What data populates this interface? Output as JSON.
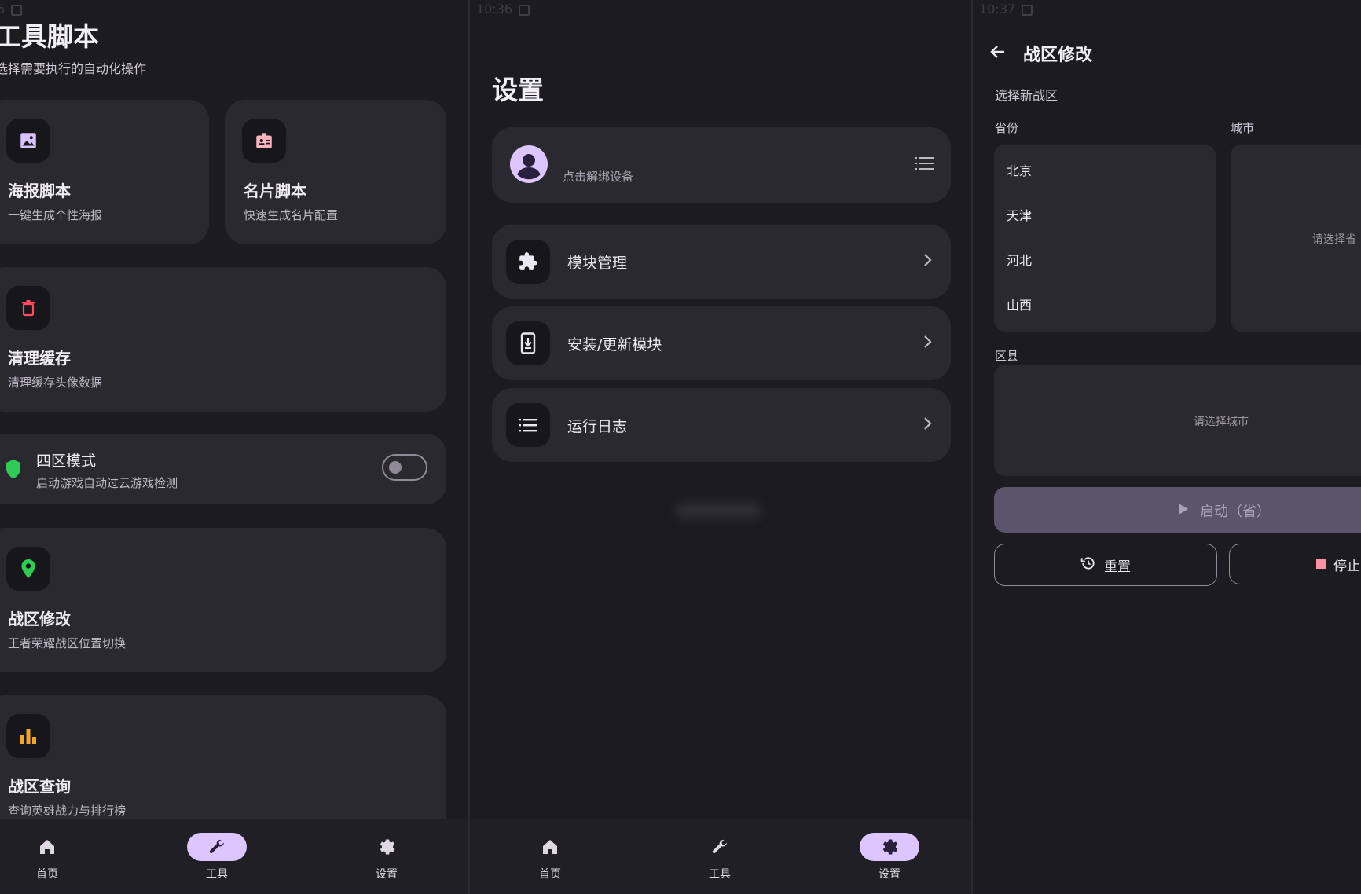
{
  "colors": {
    "background": "#1b1b20",
    "card": "#2a2930",
    "accent": "#ddc6ff",
    "start_button": "#5a556a"
  },
  "tools_page": {
    "status_time": "6",
    "title": "工具脚本",
    "subtitle": "选择需要执行的自动化操作",
    "cards": [
      {
        "icon": "image-icon",
        "title": "海报脚本",
        "sub": "一键生成个性海报"
      },
      {
        "icon": "id-card-icon",
        "title": "名片脚本",
        "sub": "快速生成名片配置"
      },
      {
        "icon": "trash-icon",
        "title": "清理缓存",
        "sub": "清理缓存头像数据"
      },
      {
        "icon": "location-pin-icon",
        "title": "战区修改",
        "sub": "王者荣耀战区位置切换"
      },
      {
        "icon": "bar-chart-icon",
        "title": "战区查询",
        "sub": "查询英雄战力与排行榜"
      }
    ],
    "toggle": {
      "icon": "shield-icon",
      "title": "四区模式",
      "sub": "启动游戏自动过云游戏检测",
      "on": false
    }
  },
  "settings_page": {
    "status_time": "10:36",
    "title": "设置",
    "device_hint": "点击解绑设备",
    "rows": [
      {
        "icon": "puzzle-icon",
        "label": "模块管理"
      },
      {
        "icon": "phone-download-icon",
        "label": "安装/更新模块"
      },
      {
        "icon": "list-icon",
        "label": "运行日志"
      }
    ]
  },
  "zone_page": {
    "status_time": "10:37",
    "title": "战区修改",
    "select_label": "选择新战区",
    "province_label": "省份",
    "city_label": "城市",
    "provinces": [
      "北京",
      "天津",
      "河北",
      "山西"
    ],
    "city_hint": "请选择省",
    "district_label": "区县",
    "district_hint": "请选择城市",
    "start_button": "启动（省）",
    "reset_button": "重置",
    "stop_button": "停止"
  },
  "nav": {
    "home": "首页",
    "tools": "工具",
    "settings": "设置"
  }
}
